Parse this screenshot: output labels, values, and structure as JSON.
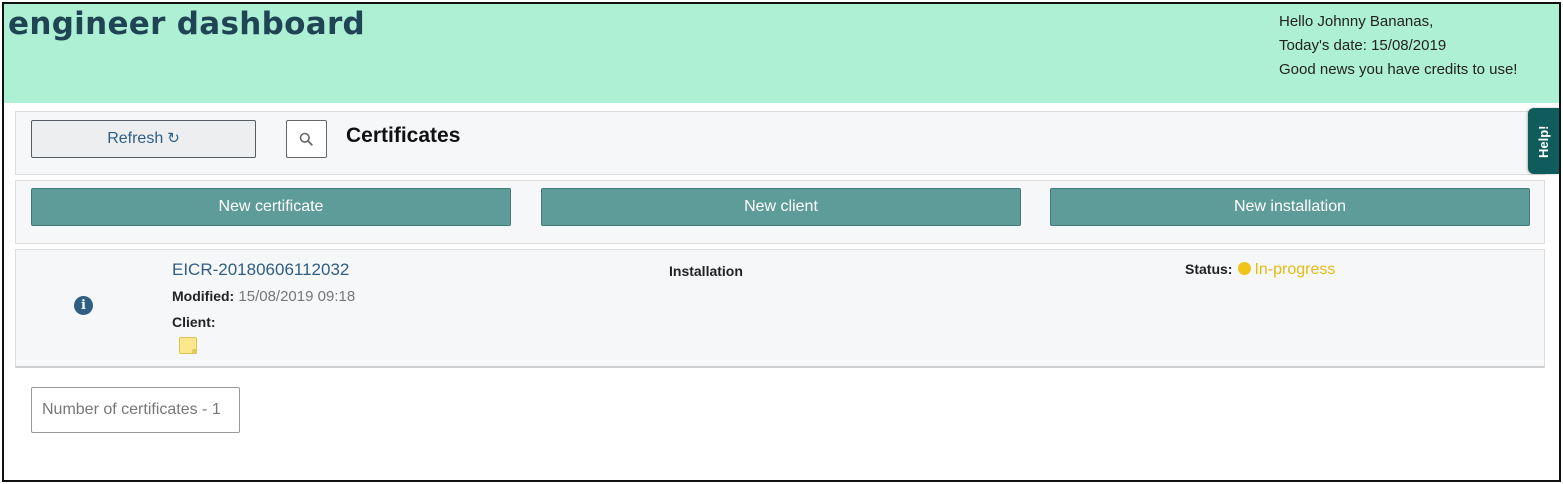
{
  "header": {
    "brand": "engineer dashboard",
    "greeting_line1": "Hello Johnny Bananas,",
    "greeting_line2": "Today's date: 15/08/2019",
    "greeting_line3": "Good news you have credits to use!"
  },
  "toolbar": {
    "refresh_label": "Refresh",
    "refresh_icon": "refresh-icon",
    "search_icon": "search-icon",
    "title": "Certificates"
  },
  "actions": {
    "new_certificate": "New certificate",
    "new_client": "New client",
    "new_installation": "New installation"
  },
  "certificate": {
    "id": "EICR-20180606112032",
    "modified_label": "Modified:",
    "modified_value": "15/08/2019 09:18",
    "client_label": "Client:",
    "installation_label": "Installation",
    "status_label": "Status:",
    "status_value": "In-progress",
    "status_color": "#f0c419"
  },
  "footer": {
    "count_text": "Number of certificates - 1"
  },
  "help": {
    "label": "Help!"
  },
  "colors": {
    "header_bg": "#aef0d3",
    "button_teal": "#5e9c99",
    "link_blue": "#2f5e85",
    "help_tab": "#105c5c"
  }
}
